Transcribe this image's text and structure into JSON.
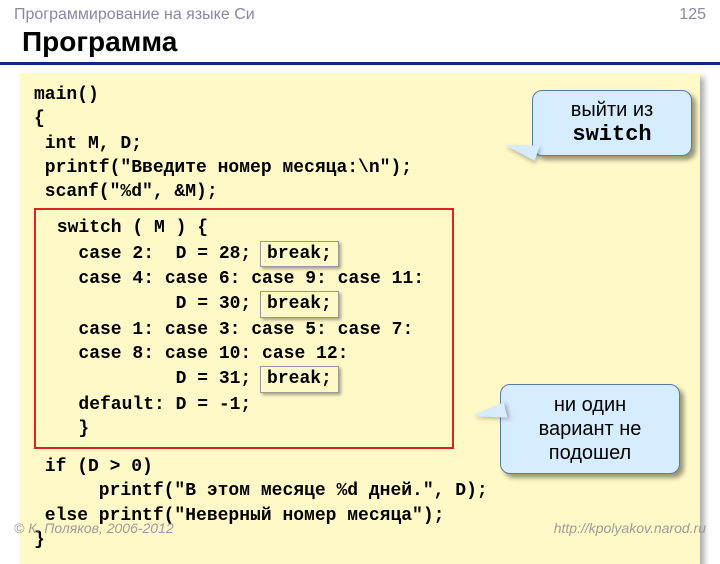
{
  "header": {
    "subject": "Программирование на языке Си",
    "page": "125"
  },
  "title": "Программа",
  "code": {
    "l1": "main()",
    "l2": "{",
    "l3": " int M, D;",
    "l4": " printf(\"Введите номер месяца:\\n\");",
    "l5": " scanf(\"%d\", &M);",
    "sw_open": " switch ( M ) {",
    "sw_c2a": "   case 2:  D = 28; ",
    "sw_c4": "   case 4: case 6: case 9: case 11:",
    "sw_d30": "            D = 30; ",
    "sw_c1": "   case 1: case 3: case 5: case 7:",
    "sw_c8": "   case 8: case 10: case 12:",
    "sw_d31": "            D = 31; ",
    "sw_def": "   default: D = -1;",
    "sw_close": "   }",
    "break": "break;",
    "if1": " if (D > 0)",
    "if2": "      printf(\"В этом месяце %d дней.\", D);",
    "if3": " else printf(\"Неверный номер месяца\");",
    "end": "}"
  },
  "callouts": {
    "top_line1": "выйти из",
    "top_line2": "switch",
    "bot_line1": "ни один",
    "bot_line2": "вариант не",
    "bot_line3": "подошел"
  },
  "footer": {
    "left": "© К. Поляков, 2006-2012",
    "right": "http://kpolyakov.narod.ru"
  }
}
